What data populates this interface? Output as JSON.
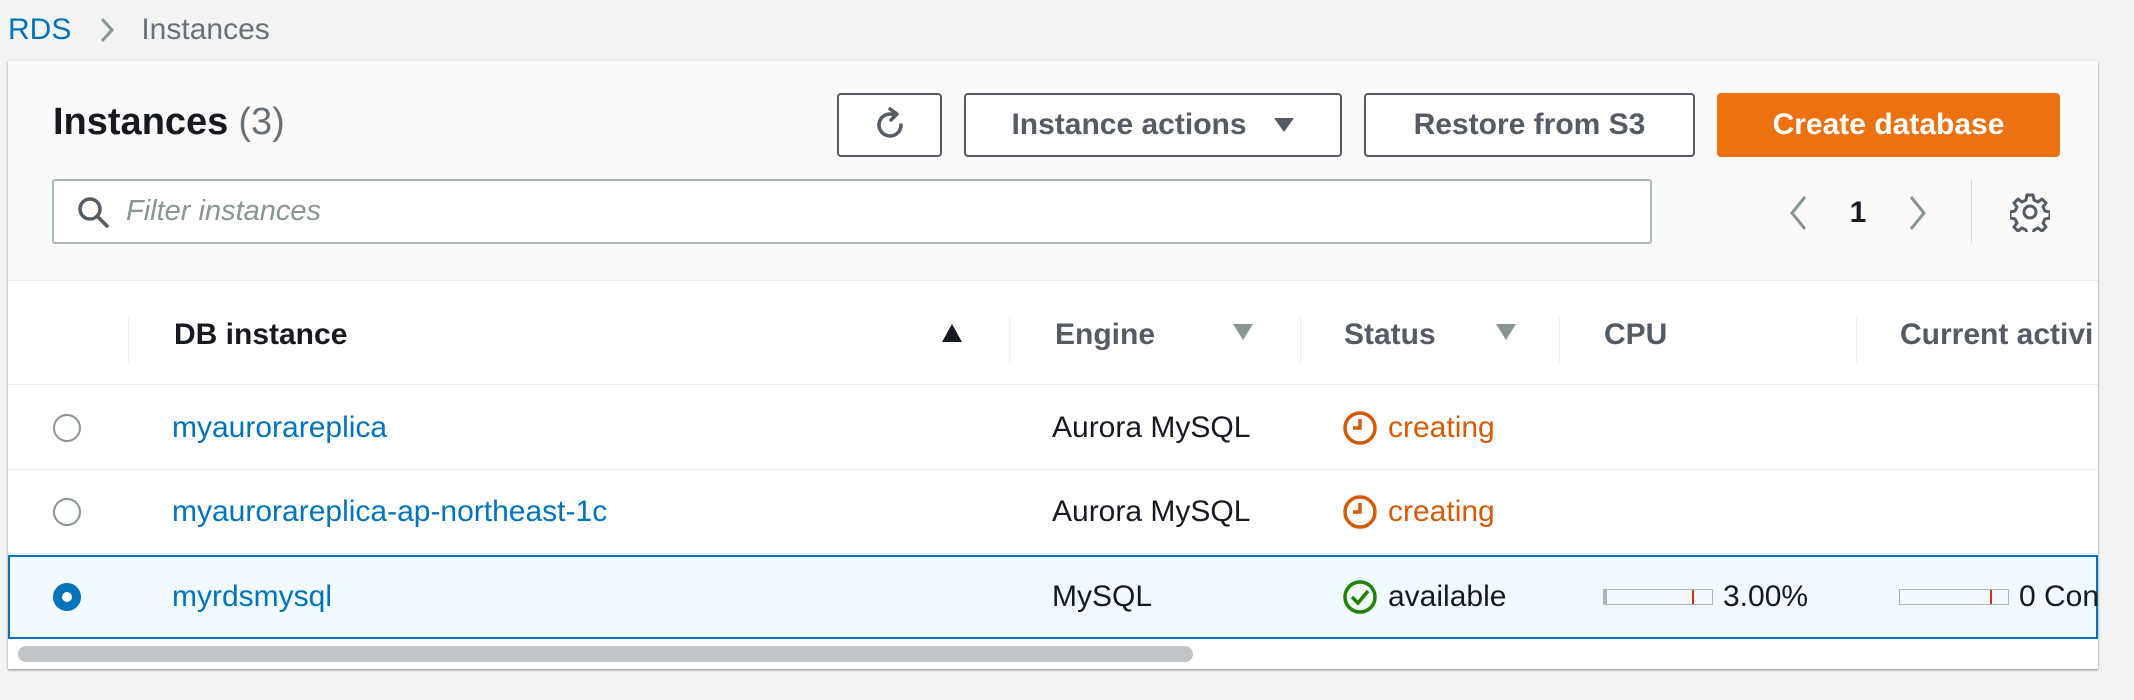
{
  "breadcrumb": {
    "root": "RDS",
    "current": "Instances"
  },
  "panel": {
    "title": "Instances",
    "count": "(3)",
    "buttons": {
      "instance_actions": "Instance actions",
      "restore": "Restore from S3",
      "create": "Create database"
    },
    "filter_placeholder": "Filter instances",
    "page": "1"
  },
  "columns": {
    "db_instance": "DB instance",
    "engine": "Engine",
    "status": "Status",
    "cpu": "CPU",
    "current_activity": "Current activi"
  },
  "rows": [
    {
      "name": "myaurorareplica",
      "engine": "Aurora MySQL",
      "status": "creating",
      "selected": false
    },
    {
      "name": "myaurorareplica-ap-northeast-1c",
      "engine": "Aurora MySQL",
      "status": "creating",
      "selected": false
    },
    {
      "name": "myrdsmysql",
      "engine": "MySQL",
      "status": "available",
      "cpu": "3.00%",
      "cpu_fraction": 0.03,
      "activity": "0 Con",
      "selected": true
    }
  ],
  "colors": {
    "accent": "#0073bb",
    "create": "#ec7211",
    "creating": "#d45b07",
    "available": "#1d8102"
  },
  "icons": {
    "breadcrumb_sep": "chevron-right-icon",
    "refresh": "refresh-icon",
    "dropdown": "caret-down-icon",
    "search": "search-icon",
    "prev": "chevron-left-icon",
    "next": "chevron-right-icon",
    "settings": "gear-icon",
    "sort_asc": "caret-up-icon",
    "creating": "clock-icon",
    "available": "check-circle-icon"
  }
}
